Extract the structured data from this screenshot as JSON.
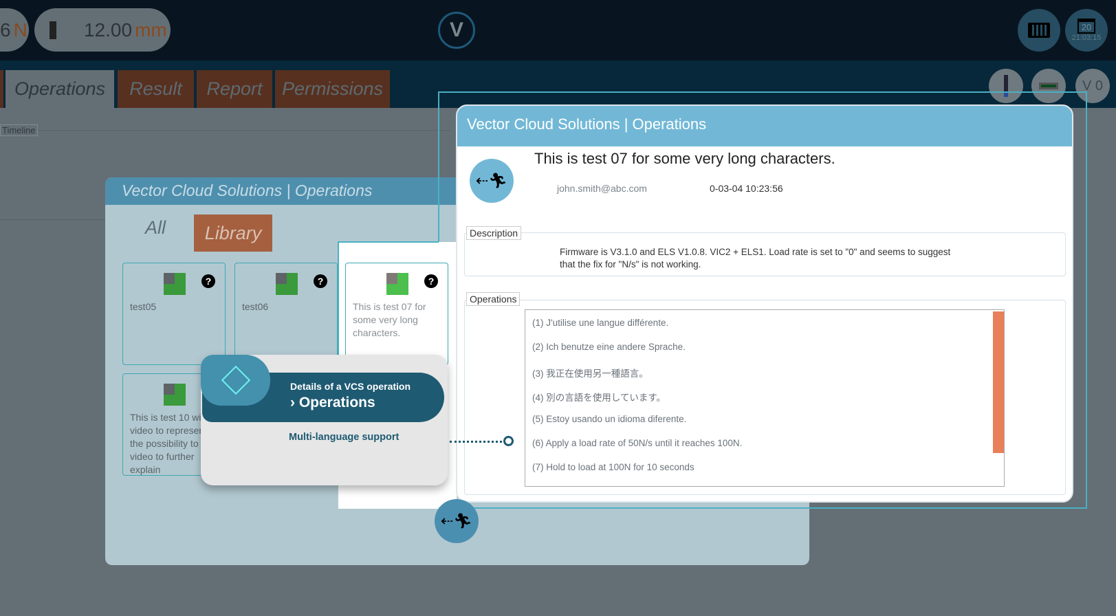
{
  "topbar": {
    "force_value": "6",
    "force_unit": "N",
    "distance_value": "12.00",
    "distance_unit": "mm",
    "calendar_day": "20",
    "clock": "21:03:15",
    "logo_text": "V"
  },
  "tabs": [
    {
      "label": "Operations",
      "active": true
    },
    {
      "label": "Result"
    },
    {
      "label": "Report"
    },
    {
      "label": "Permissions"
    }
  ],
  "right_buttons": {
    "v0_label": "V 0"
  },
  "timeline_label": "Timeline",
  "library_panel": {
    "title": "Vector Cloud Solutions | Operations",
    "tab_all": "All",
    "tab_library": "Library",
    "tiles": [
      {
        "name": "test05"
      },
      {
        "name": "test06"
      },
      {
        "name": "This is test 07 for some very long characters."
      },
      {
        "name": "This is test 10 with video to represent the possibility to add video to further explain"
      }
    ]
  },
  "detail_modal": {
    "title": "Vector Cloud Solutions | Operations",
    "op_title": "This is test 07 for some very long characters.",
    "author": "john.smith@abc.com",
    "date": "0-03-04 10:23:56",
    "description_label": "Description",
    "description": "Firmware is V3.1.0 and ELS V1.0.8. VIC2 + ELS1. Load rate is set to \"0\" and seems to suggest that the fix for \"N/s\" is not working.",
    "operations_label": "Operations",
    "operations": [
      "(1) J'utilise une langue différente.",
      "(2) Ich benutze eine andere Sprache.",
      "(3) 我正在使用另一種語言。",
      "(4) 別の言語を使用しています。",
      "(5) Estoy usando un idioma diferente.",
      "(6) Apply a load rate of 50N/s until it reaches 100N.",
      "(7) Hold to load at 100N for 10 seconds"
    ]
  },
  "tutorial_tip": {
    "subtitle": "Details of a VCS operation",
    "title": "Operations",
    "body": "Multi-language support"
  },
  "colors": {
    "accent_tab": "#a5603f",
    "modal_header": "#72b8d6",
    "tip_header": "#1e5a72",
    "scrollbar": "#e8805a",
    "highlight": "#4ab0c4"
  }
}
